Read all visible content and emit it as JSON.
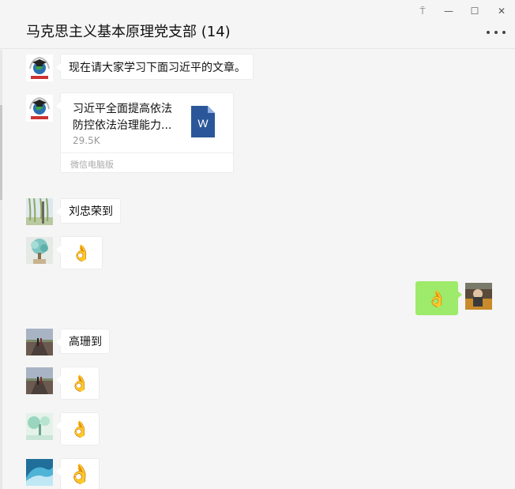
{
  "window": {
    "title": "马克思主义基本原理党支部 (14)",
    "controls": {
      "pin": "⍑",
      "minimize": "—",
      "maximize": "☐",
      "close": "✕"
    }
  },
  "messages": [
    {
      "type": "text",
      "side": "left",
      "text": "现在请大家学习下面习近平的文章。",
      "avatar": "university-logo-avatar"
    },
    {
      "type": "file",
      "side": "left",
      "avatar": "university-logo-avatar",
      "file": {
        "name": "习近平全面提高依法防控依法治理能力...",
        "size": "29.5K",
        "source": "微信电脑版",
        "icon_letter": "W",
        "icon_color": "#2b579a"
      }
    },
    {
      "type": "text",
      "side": "left",
      "text": "刘忠荣到",
      "avatar": "willow-tree-avatar"
    },
    {
      "type": "emoji",
      "side": "left",
      "text": "👌",
      "avatar": "blue-flowers-avatar"
    },
    {
      "type": "emoji",
      "side": "right",
      "text": "👌",
      "avatar": "outdoor-person-avatar"
    },
    {
      "type": "text",
      "side": "left",
      "text": "高珊到",
      "avatar": "road-couple-avatar"
    },
    {
      "type": "emoji",
      "side": "left",
      "text": "👌",
      "avatar": "road-couple-avatar"
    },
    {
      "type": "emoji",
      "side": "left",
      "text": "👌",
      "avatar": "tree-illustration-avatar"
    },
    {
      "type": "emoji",
      "side": "left",
      "text": "👌",
      "avatar": "ocean-wave-avatar"
    }
  ],
  "colors": {
    "self_bubble": "#9eea6a",
    "other_bubble": "#ffffff",
    "background": "#f5f5f5"
  }
}
